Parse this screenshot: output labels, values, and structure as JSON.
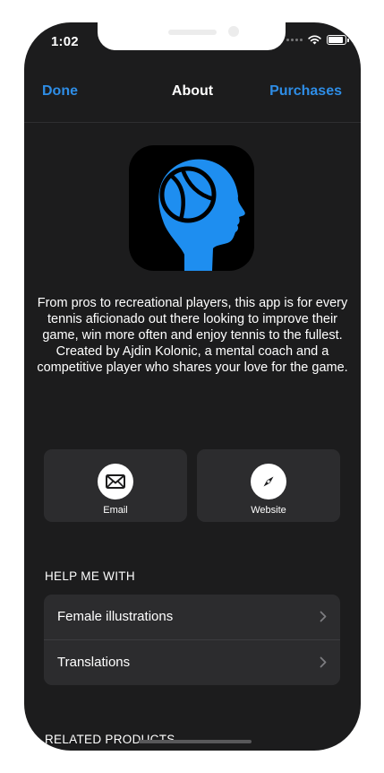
{
  "status_bar": {
    "time": "1:02"
  },
  "nav": {
    "done": "Done",
    "title": "About",
    "purchases": "Purchases"
  },
  "app_icon": {
    "name": "tennis-brain-icon",
    "head_color": "#1e8ef0",
    "background": "#000000"
  },
  "description": "From pros to recreational players, this app is for every tennis aficionado out there looking to improve their game, win more often and enjoy tennis to the fullest. Created by Ajdin Kolonic, a mental coach and a competitive player who shares your love for the game.",
  "contact": {
    "email": {
      "label": "Email",
      "icon": "envelope-icon"
    },
    "website": {
      "label": "Website",
      "icon": "compass-icon"
    }
  },
  "help_section": {
    "header": "HELP ME WITH",
    "items": [
      {
        "label": "Female illustrations"
      },
      {
        "label": "Translations"
      }
    ]
  },
  "related_section": {
    "header": "RELATED PRODUCTS"
  },
  "colors": {
    "accent": "#2e8de6",
    "background": "#1c1c1d",
    "card": "#2c2c2e"
  }
}
